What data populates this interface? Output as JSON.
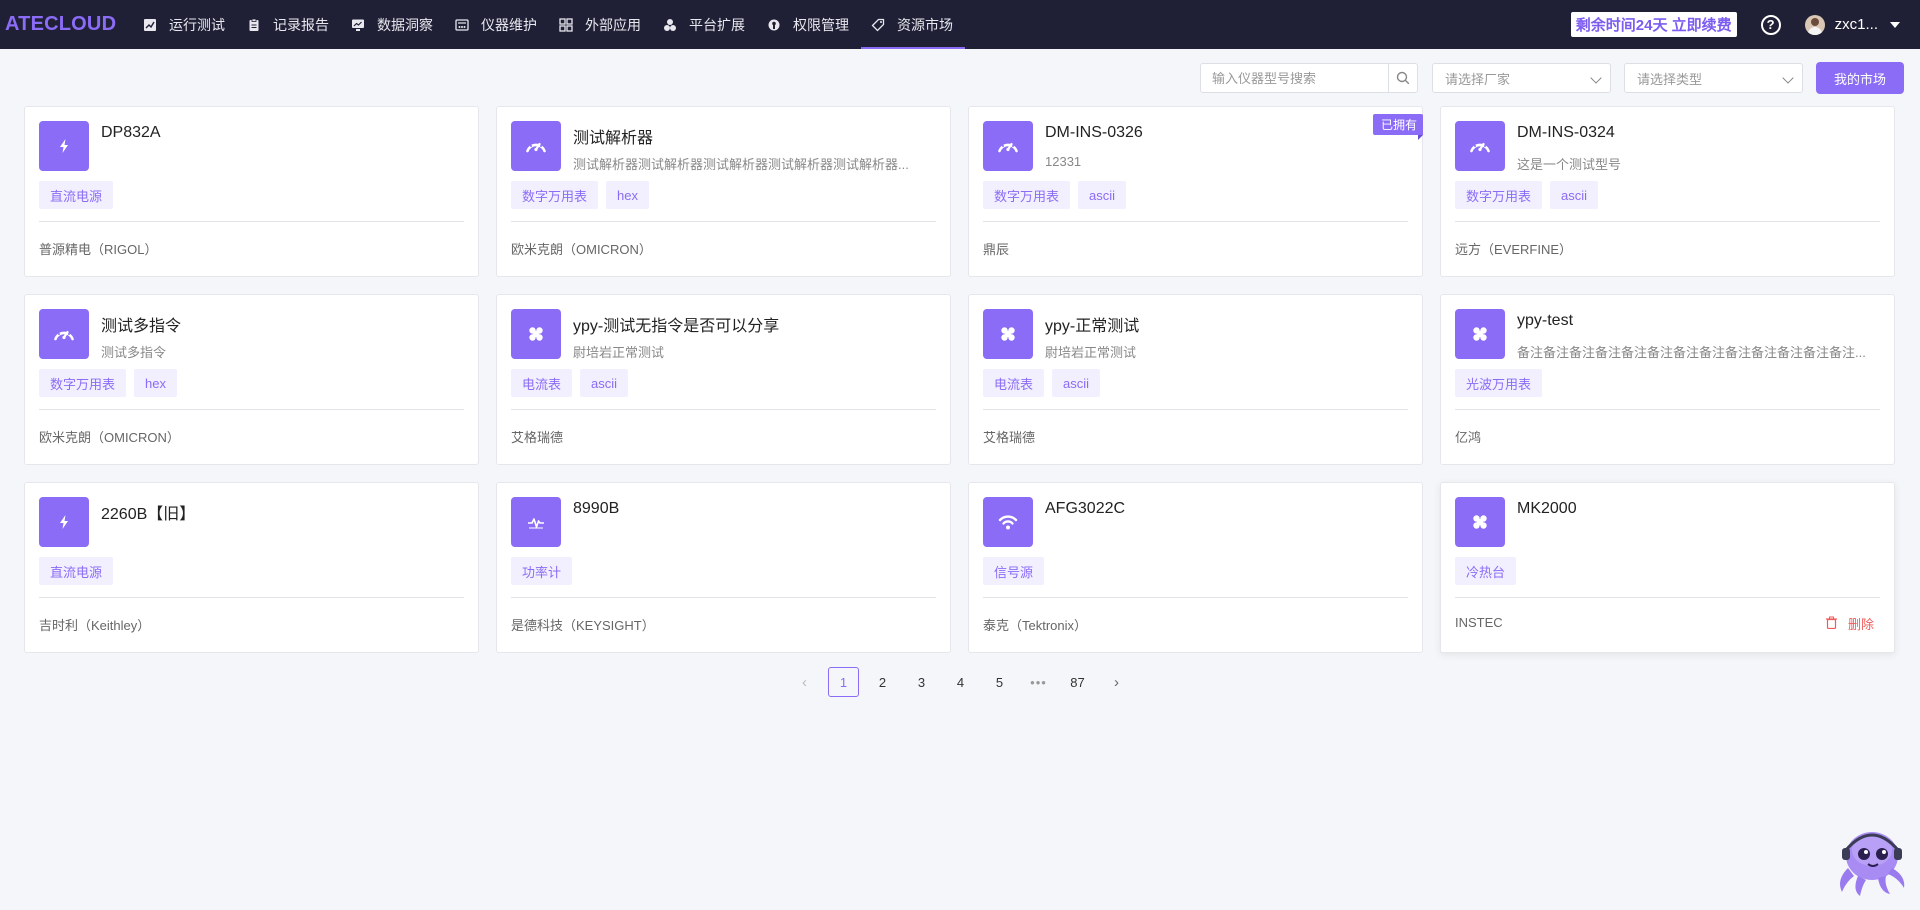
{
  "app": {
    "logo": "ATECLOUD"
  },
  "nav": [
    {
      "label": "运行测试",
      "icon": "chart-line-icon",
      "active": false
    },
    {
      "label": "记录报告",
      "icon": "clipboard-icon",
      "active": false
    },
    {
      "label": "数据洞察",
      "icon": "monitor-chart-icon",
      "active": false
    },
    {
      "label": "仪器维护",
      "icon": "instrument-icon",
      "active": false
    },
    {
      "label": "外部应用",
      "icon": "grid-apps-icon",
      "active": false
    },
    {
      "label": "平台扩展",
      "icon": "extension-icon",
      "active": false
    },
    {
      "label": "权限管理",
      "icon": "permission-icon",
      "active": false
    },
    {
      "label": "资源市场",
      "icon": "tag-icon",
      "active": true
    }
  ],
  "header": {
    "renew": "剩余时间24天 立即续费",
    "help": "?",
    "user": "zxc1..."
  },
  "filters": {
    "search_placeholder": "输入仪器型号搜索",
    "vendor_placeholder": "请选择厂家",
    "type_placeholder": "请选择类型",
    "my_market": "我的市场"
  },
  "cards": [
    {
      "name": "DP832A",
      "desc": "",
      "tags": [
        "直流电源"
      ],
      "vendor": "普源精电（RIGOL）",
      "icon": "lightning-icon",
      "owned": false
    },
    {
      "name": "测试解析器",
      "desc": "测试解析器测试解析器测试解析器测试解析器测试解析器...",
      "tags": [
        "数字万用表",
        "hex"
      ],
      "vendor": "欧米克朗（OMICRON）",
      "icon": "gauge-icon",
      "owned": false
    },
    {
      "name": "DM-INS-0326",
      "desc": "12331",
      "tags": [
        "数字万用表",
        "ascii"
      ],
      "vendor": "鼎辰",
      "icon": "gauge-icon",
      "owned": true,
      "owned_label": "已拥有"
    },
    {
      "name": "DM-INS-0324",
      "desc": "这是一个测试型号",
      "tags": [
        "数字万用表",
        "ascii"
      ],
      "vendor": "远方（EVERFINE）",
      "icon": "gauge-icon",
      "owned": false
    },
    {
      "name": "测试多指令",
      "desc": "测试多指令",
      "tags": [
        "数字万用表",
        "hex"
      ],
      "vendor": "欧米克朗（OMICRON）",
      "icon": "gauge-icon",
      "owned": false
    },
    {
      "name": "ypy-测试无指令是否可以分享",
      "desc": "尉培岩正常测试",
      "tags": [
        "电流表",
        "ascii"
      ],
      "vendor": "艾格瑞德",
      "icon": "clover-icon",
      "owned": false
    },
    {
      "name": "ypy-正常测试",
      "desc": "尉培岩正常测试",
      "tags": [
        "电流表",
        "ascii"
      ],
      "vendor": "艾格瑞德",
      "icon": "clover-icon",
      "owned": false
    },
    {
      "name": "ypy-test",
      "desc": "备注备注备注备注备注备注备注备注备注备注备注备注备注...",
      "tags": [
        "光波万用表"
      ],
      "vendor": "亿鸿",
      "icon": "clover-icon",
      "owned": false
    },
    {
      "name": "2260B【旧】",
      "desc": "",
      "tags": [
        "直流电源"
      ],
      "vendor": "吉时利（Keithley）",
      "icon": "lightning-icon",
      "owned": false
    },
    {
      "name": "8990B",
      "desc": "",
      "tags": [
        "功率计"
      ],
      "vendor": "是德科技（KEYSIGHT）",
      "icon": "pulse-icon",
      "owned": false
    },
    {
      "name": "AFG3022C",
      "desc": "",
      "tags": [
        "信号源"
      ],
      "vendor": "泰克（Tektronix）",
      "icon": "wifi-signal-icon",
      "owned": false
    },
    {
      "name": "MK2000",
      "desc": "",
      "tags": [
        "冷热台"
      ],
      "vendor": "INSTEC",
      "icon": "clover-icon",
      "owned": false,
      "delete_label": "删除"
    }
  ],
  "pagination": {
    "pages": [
      "1",
      "2",
      "3",
      "4",
      "5"
    ],
    "ellipsis": "•••",
    "last": "87",
    "current": "1",
    "prev": "‹",
    "next": "›"
  },
  "colors": {
    "accent": "#8b6cf6",
    "topbar": "#1f2036",
    "danger": "#f05b5b",
    "background": "#f5f6f9"
  }
}
